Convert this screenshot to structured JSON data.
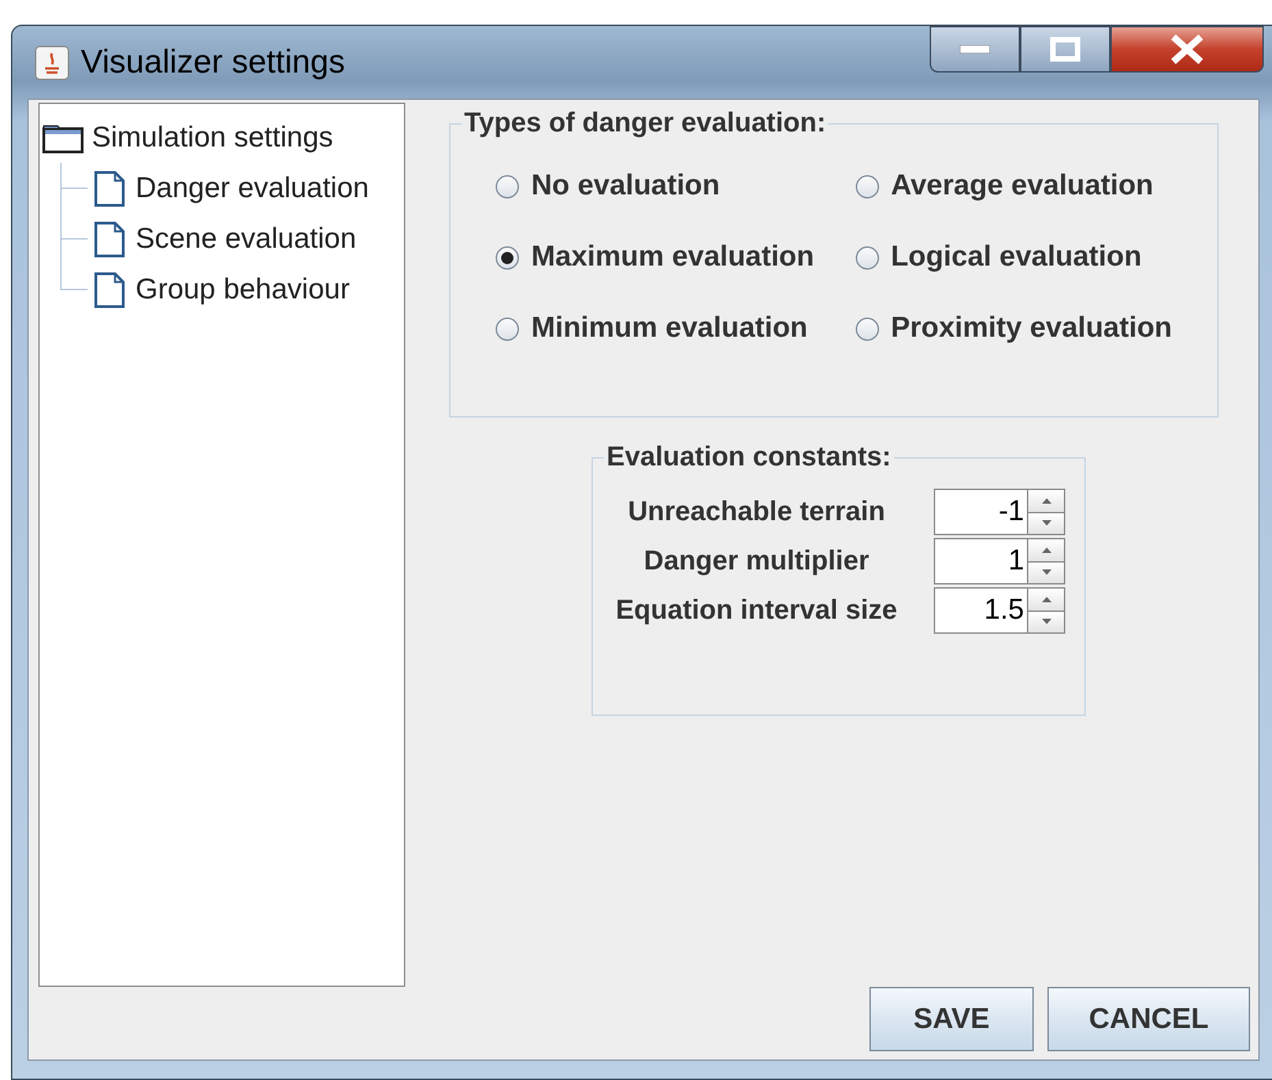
{
  "window": {
    "title": "Visualizer settings"
  },
  "tree": {
    "label": "Simulation settings",
    "children": [
      {
        "label": "Danger evaluation"
      },
      {
        "label": "Scene evaluation"
      },
      {
        "label": "Group behaviour"
      }
    ]
  },
  "danger_types": {
    "title": "Types of danger evaluation:",
    "options": [
      {
        "label": "No evaluation",
        "selected": false
      },
      {
        "label": "Average evaluation",
        "selected": false
      },
      {
        "label": "Maximum evaluation",
        "selected": true
      },
      {
        "label": "Logical evaluation",
        "selected": false
      },
      {
        "label": "Minimum evaluation",
        "selected": false
      },
      {
        "label": "Proximity evaluation",
        "selected": false
      }
    ]
  },
  "constants": {
    "title": "Evaluation constants:",
    "fields": [
      {
        "label": "Unreachable terrain",
        "value": "-1"
      },
      {
        "label": "Danger multiplier",
        "value": "1"
      },
      {
        "label": "Equation interval size",
        "value": "1.5"
      }
    ]
  },
  "buttons": [
    "SAVE",
    "CANCEL"
  ]
}
